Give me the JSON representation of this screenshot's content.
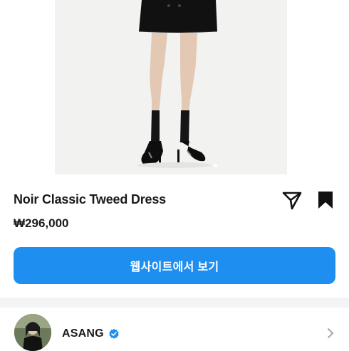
{
  "product": {
    "title": "Noir Classic Tweed Dress",
    "price": "₩296,000",
    "image_slides": 2,
    "image_active_slide": 1
  },
  "actions": {
    "share_icon": "send-icon",
    "bookmark_icon": "bookmark-icon",
    "website_button_label": "웹사이트에서 보기"
  },
  "seller": {
    "name": "ASANG",
    "verified_icon": "verified-badge-icon",
    "chevron_icon": "chevron-right-icon"
  },
  "colors": {
    "accent": "#1e8ff0",
    "text": "#1a1a1a",
    "divider": "#f3f4f6"
  }
}
